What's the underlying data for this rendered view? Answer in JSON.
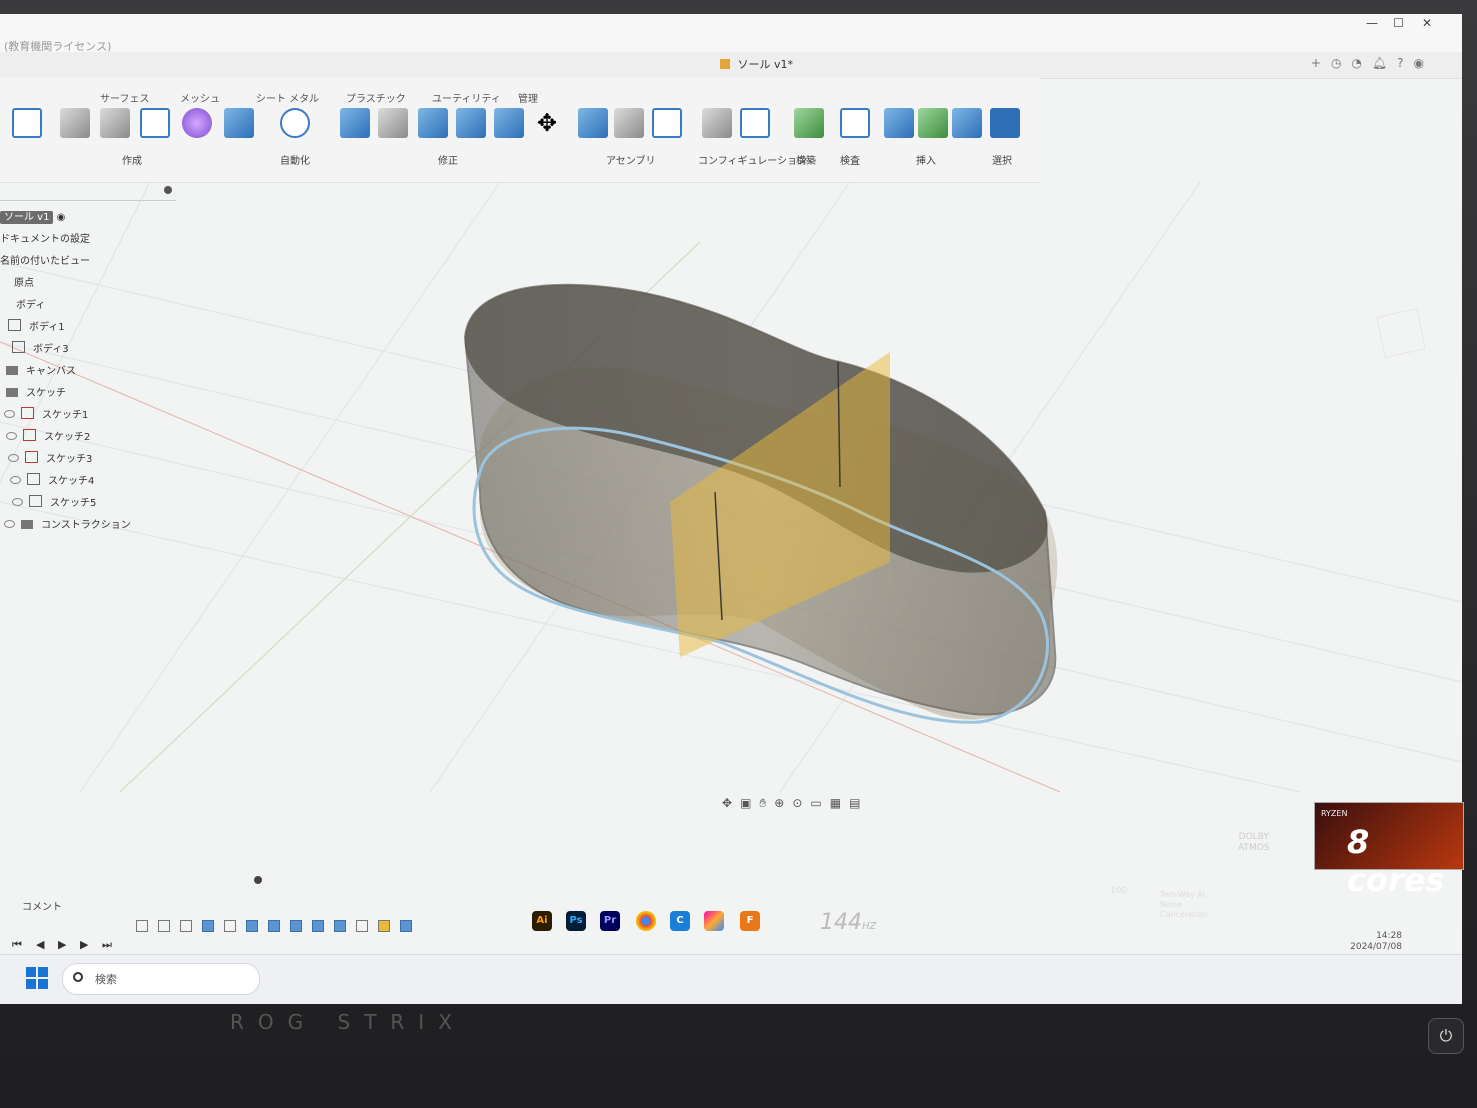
{
  "window": {
    "license_text": "(教育機関ライセンス)",
    "controls": [
      "—",
      "☐",
      "✕"
    ]
  },
  "document": {
    "title": "ソール v1*"
  },
  "ribbon": {
    "tabs": [
      "サーフェス",
      "メッシュ",
      "シート メタル",
      "プラスチック",
      "ユーティリティ",
      "管理"
    ],
    "groups": [
      "作成",
      "自動化",
      "修正",
      "アセンブリ",
      "コンフィギュレーション",
      "構築",
      "検査",
      "挿入",
      "選択"
    ]
  },
  "browser": {
    "root": "ソール v1",
    "items": [
      {
        "label": "ドキュメントの設定",
        "icon": "gear-icon"
      },
      {
        "label": "名前の付いたビュー",
        "icon": "folder-icon"
      },
      {
        "label": "原点",
        "icon": "folder-icon"
      },
      {
        "label": "ボディ",
        "icon": "folder-icon"
      },
      {
        "label": "ボディ1",
        "icon": "body-icon"
      },
      {
        "label": "ボディ3",
        "icon": "body-icon"
      },
      {
        "label": "キャンバス",
        "icon": "folder-icon"
      },
      {
        "label": "スケッチ",
        "icon": "folder-icon"
      },
      {
        "label": "スケッチ1",
        "icon": "sketch-icon"
      },
      {
        "label": "スケッチ2",
        "icon": "sketch-icon"
      },
      {
        "label": "スケッチ3",
        "icon": "sketch-icon"
      },
      {
        "label": "スケッチ4",
        "icon": "sketch-icon"
      },
      {
        "label": "スケッチ5",
        "icon": "sketch-icon"
      },
      {
        "label": "コンストラクション",
        "icon": "folder-icon"
      }
    ]
  },
  "comment": {
    "label": "コメント"
  },
  "taskbar": {
    "search_placeholder": "検索",
    "apps": [
      "Ai",
      "Ps",
      "Pr",
      "C",
      "F"
    ],
    "time": "14:28",
    "date": "2024/07/08"
  },
  "hardware": {
    "refresh": "144",
    "refresh_unit": "HZ",
    "cores": "8 cores",
    "cpu_brand": "RYZEN",
    "dolby": [
      "DOLBY",
      "ATMOS"
    ],
    "speaker": "Two-Way AI Noise Cancelation",
    "volume": "100",
    "brand": "ROG STRIX"
  },
  "colors": {
    "plane": "#e9b93a",
    "model": "#6f6a60",
    "accent": "#2f6fb8"
  }
}
